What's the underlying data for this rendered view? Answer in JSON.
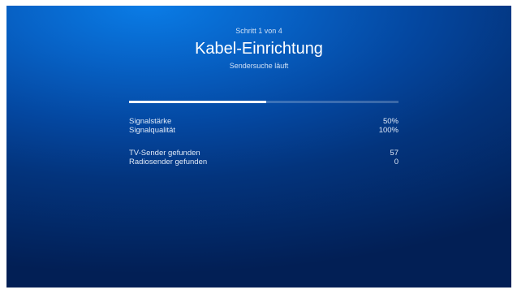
{
  "header": {
    "step": "Schritt 1 von 4",
    "title": "Kabel-Einrichtung",
    "subtitle": "Sendersuche läuft"
  },
  "progress": {
    "fraction": 0.51
  },
  "stats": {
    "signal_strength": {
      "label": "Signalstärke",
      "value": "50%"
    },
    "signal_quality": {
      "label": "Signalqualität",
      "value": "100%"
    },
    "tv_found": {
      "label": "TV-Sender gefunden",
      "value": "57"
    },
    "radio_found": {
      "label": "Radiosender gefunden",
      "value": "0"
    }
  },
  "colors": {
    "background_top": "#0a7ce6",
    "background_bottom": "#021f55",
    "progress_fill": "#ffffff"
  }
}
